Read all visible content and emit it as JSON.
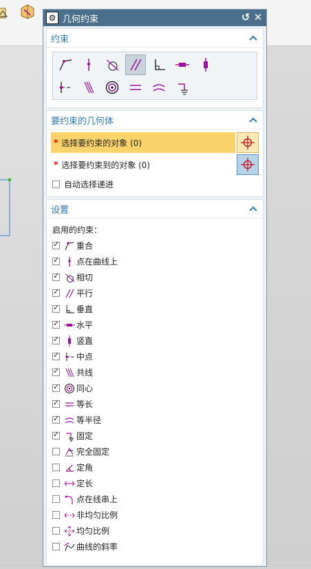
{
  "dialog": {
    "title": "几何约束",
    "reset_glyph": "↺",
    "close_glyph": "✕"
  },
  "constraints_section": {
    "header": "约束",
    "collapse_glyph": "^"
  },
  "geometry_section": {
    "header": "要约束的几何体",
    "collapse_glyph": "^",
    "select_object_label": "选择要约束的对象 (0)",
    "select_target_label": "选择要约束到的对象 (0)",
    "auto_advance_label": "自动选择递进",
    "required_mark": "*"
  },
  "settings_section": {
    "header": "设置",
    "collapse_glyph": "^",
    "enabled_label": "启用的约束：",
    "items": [
      {
        "label": "重合",
        "checked": true,
        "icon": "coincident-icon"
      },
      {
        "label": "点在曲线上",
        "checked": true,
        "icon": "point-on-curve-icon"
      },
      {
        "label": "相切",
        "checked": true,
        "icon": "tangent-icon"
      },
      {
        "label": "平行",
        "checked": true,
        "icon": "parallel-icon"
      },
      {
        "label": "垂直",
        "checked": true,
        "icon": "perpendicular-icon"
      },
      {
        "label": "水平",
        "checked": true,
        "icon": "horizontal-icon"
      },
      {
        "label": "竖直",
        "checked": true,
        "icon": "vertical-icon"
      },
      {
        "label": "中点",
        "checked": true,
        "icon": "midpoint-icon"
      },
      {
        "label": "共线",
        "checked": true,
        "icon": "collinear-icon"
      },
      {
        "label": "同心",
        "checked": true,
        "icon": "concentric-icon"
      },
      {
        "label": "等长",
        "checked": true,
        "icon": "equal-length-icon"
      },
      {
        "label": "等半径",
        "checked": true,
        "icon": "equal-radius-icon"
      },
      {
        "label": "固定",
        "checked": true,
        "icon": "fixed-icon"
      },
      {
        "label": "完全固定",
        "checked": false,
        "icon": "fully-fixed-icon"
      },
      {
        "label": "定角",
        "checked": false,
        "icon": "fixed-angle-icon"
      },
      {
        "label": "定长",
        "checked": false,
        "icon": "fixed-length-icon"
      },
      {
        "label": "点在线串上",
        "checked": false,
        "icon": "point-on-string-icon"
      },
      {
        "label": "非均匀比例",
        "checked": false,
        "icon": "non-uniform-scale-icon"
      },
      {
        "label": "均匀比例",
        "checked": false,
        "icon": "uniform-scale-icon"
      },
      {
        "label": "曲线的斜率",
        "checked": false,
        "icon": "curve-slope-icon"
      }
    ]
  },
  "colors": {
    "titlebar": "#4a6f8c",
    "section_header": "#2f78ad",
    "highlight": "#fad46b",
    "icon_purple": "#a0109c"
  }
}
